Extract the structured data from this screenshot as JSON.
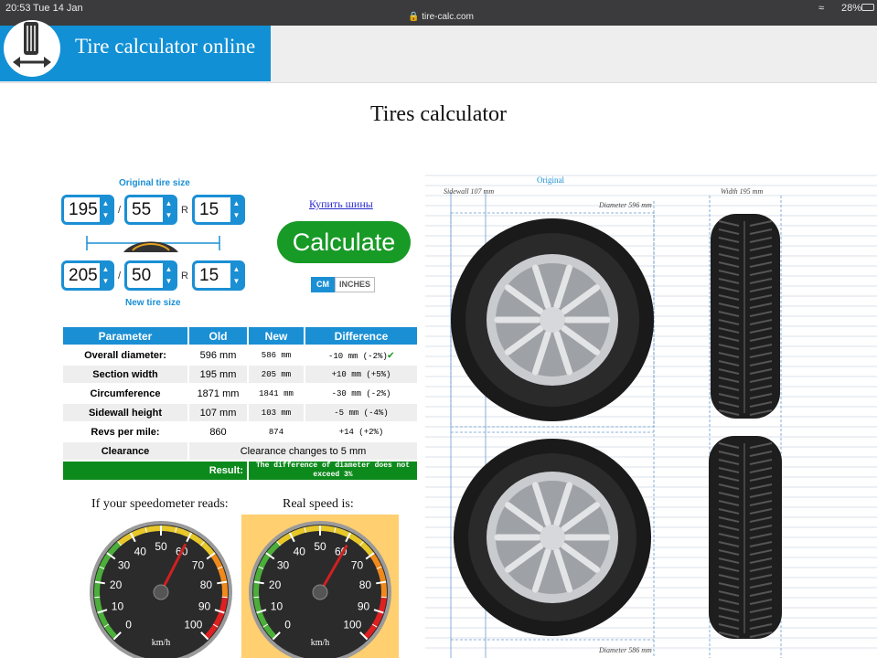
{
  "status": {
    "time": "20:53",
    "date": "Tue 14 Jan",
    "url": "tire-calc.com",
    "battery": "28%"
  },
  "header": {
    "site_title": "Tire calculator online"
  },
  "page_title": "Tires calculator",
  "original": {
    "label": "Original tire size",
    "width": "195",
    "profile": "55",
    "rim": "15"
  },
  "new": {
    "label": "New tire size",
    "width": "205",
    "profile": "50",
    "rim": "15"
  },
  "separators": {
    "slash": "/",
    "r": "R"
  },
  "buy_link": "Купить шины",
  "calculate_label": "Calculate",
  "units": {
    "cm": "CM",
    "inches": "INCHES"
  },
  "table": {
    "headers": {
      "parameter": "Parameter",
      "old": "Old",
      "new": "New",
      "difference": "Difference"
    },
    "rows": [
      {
        "param": "Overall diameter:",
        "old": "596 mm",
        "new": "586 mm",
        "diff": "-10 mm (-2%)"
      },
      {
        "param": "Section width",
        "old": "195 mm",
        "new": "205 mm",
        "diff": "+10 mm (+5%)"
      },
      {
        "param": "Circumference",
        "old": "1871 mm",
        "new": "1841 mm",
        "diff": "-30 mm (-2%)"
      },
      {
        "param": "Sidewall height",
        "old": "107 mm",
        "new": "103 mm",
        "diff": "-5 mm (-4%)"
      },
      {
        "param": "Revs per mile:",
        "old": "860",
        "new": "874",
        "diff": "+14 (+2%)"
      }
    ],
    "clearance": {
      "param": "Clearance",
      "value": "Clearance changes to 5 mm"
    },
    "result": {
      "label": "Result:",
      "text": "The difference of diameter does not exceed 3%"
    }
  },
  "speedo": {
    "caption1": "If your speedometer reads:",
    "caption2": "Real speed is:",
    "unit": "km/h",
    "ticks": [
      "0",
      "10",
      "20",
      "30",
      "40",
      "50",
      "60",
      "70",
      "80",
      "90",
      "100"
    ],
    "needle1": 60,
    "needle2": 61
  },
  "diagram": {
    "original_label": "Original",
    "sidewall": "Sidewall 107 mm",
    "width": "Width 195 mm",
    "diameter_top": "Diameter 596 mm",
    "diameter_bottom": "Diameter 586 mm"
  },
  "colors": {
    "accent": "#1a8fd4",
    "green": "#189a26",
    "result_green": "#0d8a1c"
  }
}
